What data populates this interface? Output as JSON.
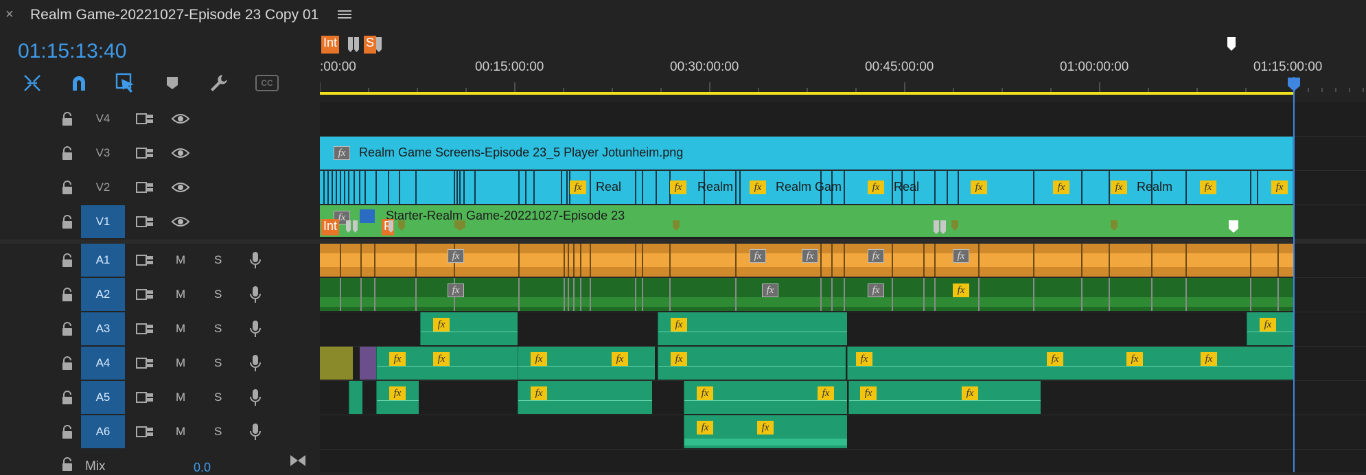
{
  "header": {
    "close_glyph": "×",
    "sequence_title": "Realm Game-20221027-Episode 23 Copy 01",
    "timecode": "01:15:13:40"
  },
  "toolbar": {
    "tools": [
      "snap-icon",
      "magnet-icon",
      "linked-selection-icon",
      "add-marker-icon",
      "wrench-icon",
      "captions-icon"
    ],
    "captions_label": "CC"
  },
  "ruler": {
    "labels": [
      ":00:00",
      "00:15:00:00",
      "00:30:00:00",
      "00:45:00:00",
      "01:00:00:00",
      "01:15:00:00"
    ],
    "top_markers": [
      "Int",
      "S"
    ]
  },
  "tracks": {
    "video": [
      {
        "id": "V4",
        "targeted": false
      },
      {
        "id": "V3",
        "targeted": false
      },
      {
        "id": "V2",
        "targeted": false
      },
      {
        "id": "V1",
        "targeted": true
      }
    ],
    "audio": [
      {
        "id": "A1",
        "mute": "M",
        "solo": "S"
      },
      {
        "id": "A2",
        "mute": "M",
        "solo": "S"
      },
      {
        "id": "A3",
        "mute": "M",
        "solo": "S"
      },
      {
        "id": "A4",
        "mute": "M",
        "solo": "S"
      },
      {
        "id": "A5",
        "mute": "M",
        "solo": "S"
      },
      {
        "id": "A6",
        "mute": "M",
        "solo": "S"
      }
    ],
    "mix": {
      "label": "Mix",
      "value": "0.0"
    }
  },
  "clips": {
    "v3_name": "Realm Game Screens-Episode 23_5 Player Jotunheim.png",
    "v2_names": [
      "Real",
      "Realm",
      "Realm Gam",
      "Real",
      "Realm"
    ],
    "v1_name": "Starter-Realm Game-20221027-Episode 23",
    "v1_markers": [
      "Int",
      "P"
    ],
    "fx_label": "fx"
  },
  "colors": {
    "accent_blue": "#3e9bea",
    "playhead": "#3e86e0",
    "work_area": "#f2e21d",
    "v3_clip": "#2dbfe0",
    "v1_clip": "#50b655",
    "audio_clip": "#1f9d71",
    "a1_clip": "#d08a2c",
    "a2_clip": "#1f6b26",
    "marker_orange": "#e8742a"
  }
}
